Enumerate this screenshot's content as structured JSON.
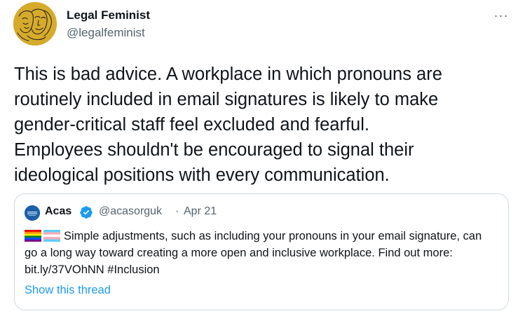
{
  "author": {
    "name": "Legal Feminist",
    "handle": "@legalfeminist",
    "avatar_color": "#d6ab2c",
    "avatar_icon": "line-drawn-faces-icon"
  },
  "more_label": "···",
  "tweet_text": "This is bad advice. A workplace in which pronouns are\nroutinely included in email signatures is likely to make\ngender-critical staff feel excluded and fearful.\nEmployees shouldn't be encouraged to signal their\nideological positions with every communication.",
  "quoted_tweet": {
    "name": "Acas",
    "verified": true,
    "handle": "@acasorguk",
    "separator": "·",
    "date": "Apr 21",
    "flags": [
      "rainbow-flag-emoji",
      "transgender-flag-emoji"
    ],
    "text": "Simple adjustments, such as including your pronouns in your email signature, can go a long way toward creating a more open and inclusive workplace. Find out more: bit.ly/37VOhNN #Inclusion",
    "show_thread_label": "Show this thread",
    "avatar_color": "#1b5fa8"
  },
  "colors": {
    "text_primary": "#0f1419",
    "text_secondary": "#536471",
    "link": "#1d9bf0",
    "border": "#cfd9de",
    "verified_badge": "#1d9bf0"
  }
}
